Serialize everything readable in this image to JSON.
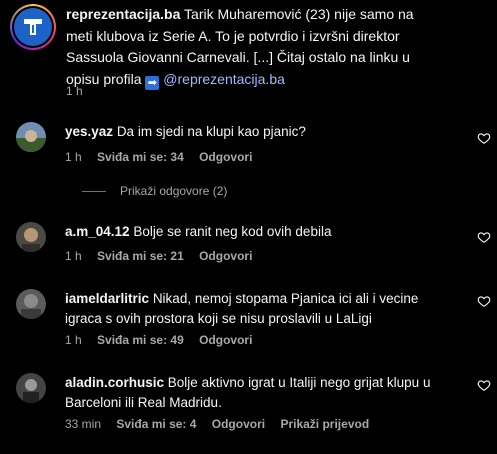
{
  "post": {
    "username": "reprezentacija.ba",
    "caption": "Tarik Muharemović (23) nije samo na meti klubova iz Serie A. To je potvrdio i izvršni direktor Sassuola Giovanni Carnevali. [...] Čitaj ostalo na linku u opisu profila",
    "arrow_glyph": "➡",
    "mention": "@reprezentacija.ba",
    "time": "1 h"
  },
  "comments": [
    {
      "username": "yes.yaz",
      "text": "Da im sjedi na klupi kao pjanic?",
      "time": "1 h",
      "likes": "Sviđa mi se: 34",
      "reply": "Odgovori",
      "view_replies": "Prikaži odgovore (2)"
    },
    {
      "username": "a.m_04.12",
      "text": "Bolje se ranit neg kod ovih debila",
      "time": "1 h",
      "likes": "Sviđa mi se: 21",
      "reply": "Odgovori"
    },
    {
      "username": "iameldarlitric",
      "text": "Nikad, nemoj stopama Pjanica ici ali i vecine igraca s ovih prostora koji se nisu proslavili u LaLigi",
      "time": "1 h",
      "likes": "Sviđa mi se: 49",
      "reply": "Odgovori"
    },
    {
      "username": "aladin.corhusic",
      "text": "Bolje aktivno igrat u Italiji nego grijat klupu u Barceloni ili Real Madridu.",
      "time": "33 min",
      "likes": "Sviđa mi se: 4",
      "reply": "Odgovori",
      "translate": "Prikaži prijevod"
    }
  ],
  "colors": {
    "background": "#000000",
    "text": "#f5f5f5",
    "secondary": "#a8a8a8",
    "mention": "#a1b9ff",
    "logo_blue": "#1d62c7"
  },
  "icons": [
    "heart-icon",
    "avatar-logo-icon",
    "arrow-right-icon"
  ]
}
